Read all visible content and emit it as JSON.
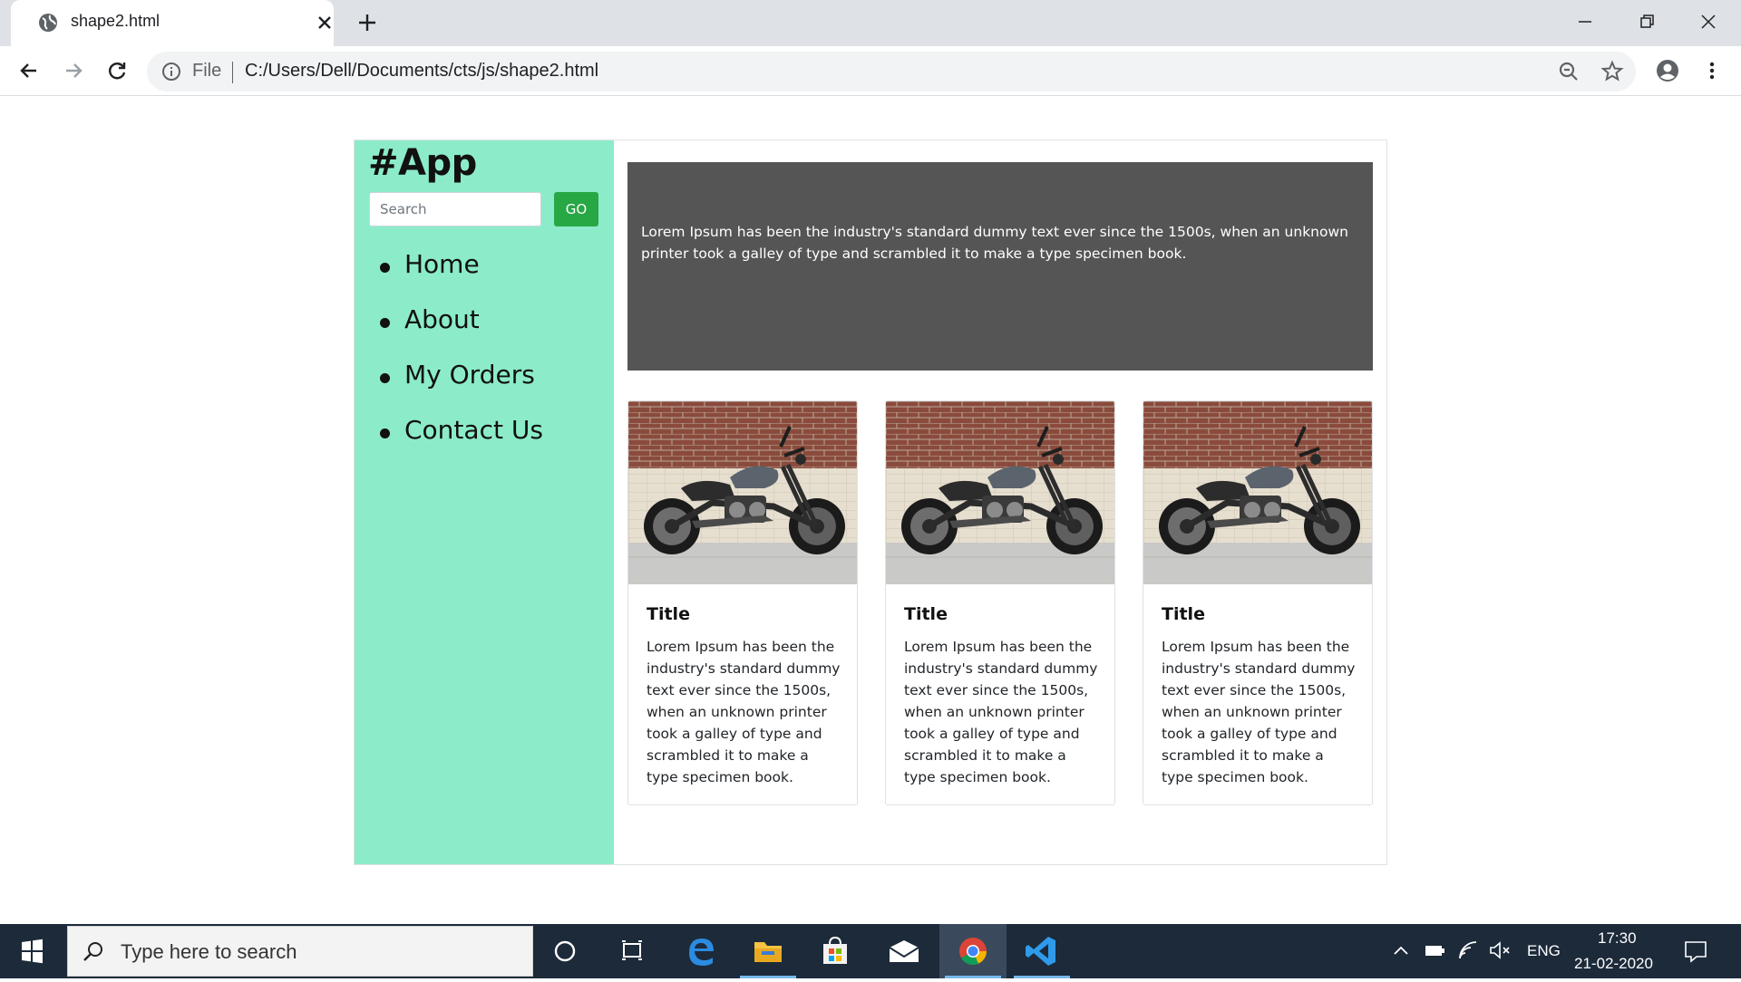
{
  "browser": {
    "tab_title": "shape2.html",
    "omnibox_scheme": "File",
    "url": "C:/Users/Dell/Documents/cts/js/shape2.html"
  },
  "page": {
    "brand": "#App",
    "search_placeholder": "Search",
    "go_label": "GO",
    "nav_items": [
      {
        "label": "Home"
      },
      {
        "label": "About"
      },
      {
        "label": "My Orders"
      },
      {
        "label": "Contact Us"
      }
    ],
    "hero_text": "Lorem Ipsum has been the industry's standard dummy text ever since the 1500s, when an unknown printer took a galley of type and scrambled it to make a type specimen book.",
    "cards": [
      {
        "title": "Title",
        "text": "Lorem Ipsum has been the industry's standard dummy text ever since the 1500s, when an unknown printer took a galley of type and scrambled it to make a type specimen book."
      },
      {
        "title": "Title",
        "text": "Lorem Ipsum has been the industry's standard dummy text ever since the 1500s, when an unknown printer took a galley of type and scrambled it to make a type specimen book."
      },
      {
        "title": "Title",
        "text": "Lorem Ipsum has been the industry's standard dummy text ever since the 1500s, when an unknown printer took a galley of type and scrambled it to make a type specimen book."
      }
    ],
    "colors": {
      "sidebar": "#8cecc9",
      "hero": "#555555",
      "go_button": "#28a745"
    }
  },
  "taskbar": {
    "search_placeholder": "Type here to search",
    "language": "ENG",
    "time": "17:30",
    "date": "21-02-2020",
    "apps": [
      "cortana-icon",
      "task-view-icon",
      "edge-icon",
      "file-explorer-icon",
      "store-icon",
      "mail-icon",
      "chrome-icon",
      "vscode-icon"
    ]
  }
}
